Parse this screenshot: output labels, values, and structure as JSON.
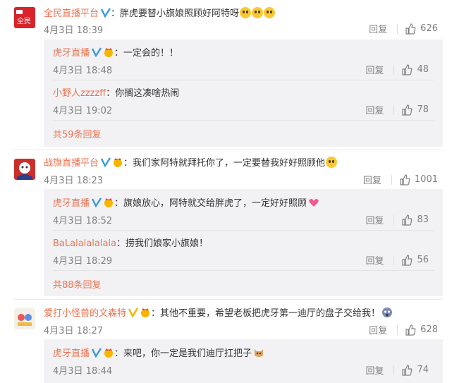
{
  "comments": [
    {
      "user": "全民直播平台",
      "text": "胖虎要替小旗娘照顾好阿特呀",
      "time": "4月3日 18:39",
      "reply": "回复",
      "likes": "626",
      "avatar_label": "全民",
      "sub": [
        {
          "user": "虎牙直播",
          "text": "一定会的！！",
          "time": "4月3日 18:48",
          "reply": "回复",
          "likes": "48"
        },
        {
          "user": "小野人zzzzff",
          "text": "你搁这凑啥热闹",
          "time": "4月3日 19:02",
          "reply": "回复",
          "likes": "78"
        }
      ],
      "more": "共59条回复"
    },
    {
      "user": "战旗直播平台",
      "text": "我们家阿特就拜托你了，一定要替我好好照顾他",
      "time": "4月3日 18:23",
      "reply": "回复",
      "likes": "1001",
      "sub": [
        {
          "user": "虎牙直播",
          "text": "旗娘放心，阿特就交给胖虎了，一定好好照顾",
          "time": "4月3日 18:52",
          "reply": "回复",
          "likes": "83"
        },
        {
          "user": "BaLalalalalala",
          "text": "捞我们娘家小旗娘！",
          "time": "4月3日 18:29",
          "reply": "回复",
          "likes": "56"
        }
      ],
      "more": "共88条回复"
    },
    {
      "user": "爱打小怪兽的文森特",
      "text": "其他不重要，希望老板把虎牙第一迪厅的盘子交给我！",
      "time": "4月3日 18:27",
      "reply": "回复",
      "likes": "628",
      "sub": [
        {
          "user": "虎牙直播",
          "text": "来吧，你一定是我们迪厅扛把子",
          "time": "4月3日 18:44",
          "reply": "回复",
          "likes": "74"
        }
      ]
    }
  ],
  "colors": {
    "username": "#eb7350",
    "sub_bg": "#f2f2f5",
    "verified": "#3d9bd8"
  }
}
